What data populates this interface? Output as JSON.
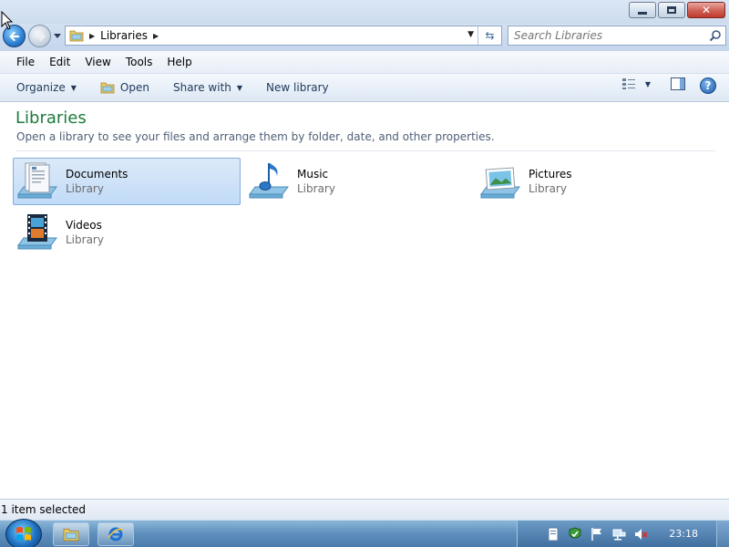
{
  "window": {
    "caption_buttons": [
      "minimize",
      "maximize",
      "close"
    ]
  },
  "address": {
    "location": "Libraries",
    "search_placeholder": "Search Libraries"
  },
  "menu": {
    "items": [
      "File",
      "Edit",
      "View",
      "Tools",
      "Help"
    ]
  },
  "commandbar": {
    "organize": "Organize",
    "open": "Open",
    "share_with": "Share with",
    "new_library": "New library"
  },
  "content": {
    "title": "Libraries",
    "description": "Open a library to see your files and arrange them by folder, date, and other properties.",
    "libraries": [
      {
        "name": "Documents",
        "type": "Library",
        "icon": "documents-library-icon",
        "selected": true
      },
      {
        "name": "Music",
        "type": "Library",
        "icon": "music-library-icon",
        "selected": false
      },
      {
        "name": "Pictures",
        "type": "Library",
        "icon": "pictures-library-icon",
        "selected": false
      },
      {
        "name": "Videos",
        "type": "Library",
        "icon": "videos-library-icon",
        "selected": false
      }
    ]
  },
  "status": {
    "text": "1 item selected"
  },
  "taskbar": {
    "clock": "23:18",
    "pinned": [
      "windows-explorer",
      "internet-explorer"
    ]
  },
  "colors": {
    "accent_title": "#1e7a3c",
    "selection_bg": "#c1dbf7",
    "taskbar": "#5e8fbc"
  }
}
